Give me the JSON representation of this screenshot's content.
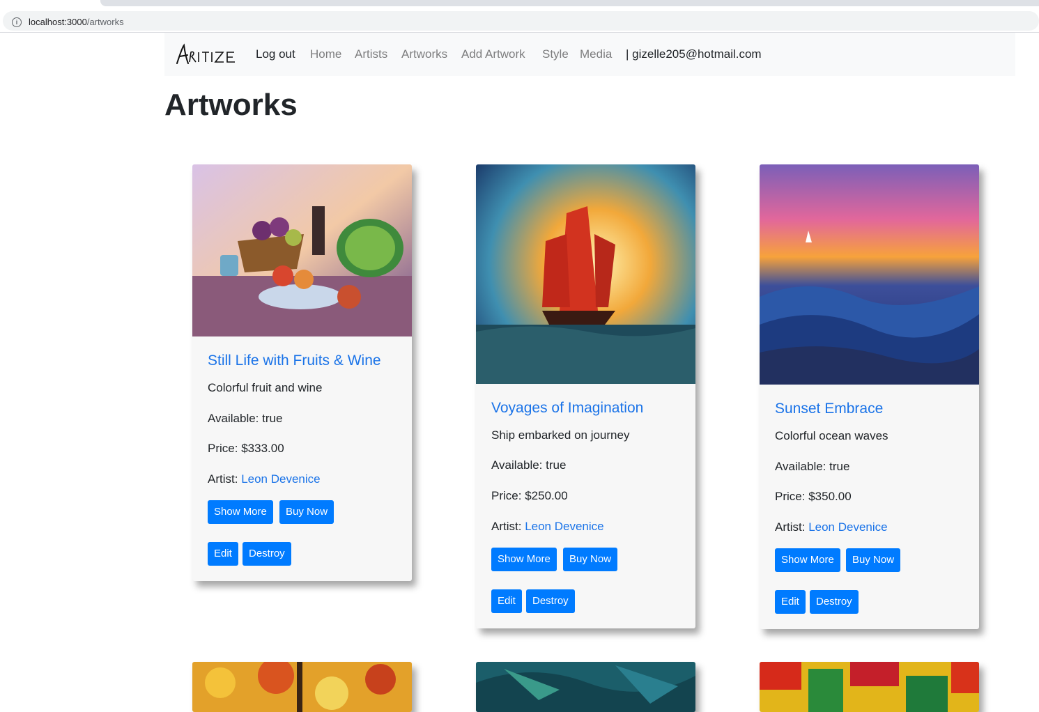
{
  "browser": {
    "url_host": "localhost:3000",
    "url_path": "/artworks"
  },
  "navbar": {
    "brand": "Aritze",
    "items": [
      "Log out",
      "Home",
      "Artists",
      "Artworks",
      "Add Artwork",
      "Style",
      "Media"
    ],
    "user_label": "| gizelle205@hotmail.com"
  },
  "page": {
    "title": "Artworks"
  },
  "labels": {
    "available": "Available:",
    "price": "Price:",
    "artist": "Artist:"
  },
  "buttons": {
    "show_more": "Show More",
    "buy_now": "Buy Now",
    "edit": "Edit",
    "destroy": "Destroy"
  },
  "artworks": [
    {
      "title": "Still Life with Fruits & Wine",
      "description": "Colorful fruit and wine",
      "available": "true",
      "price": "$333.00",
      "artist": "Leon Devenice"
    },
    {
      "title": "Voyages of Imagination",
      "description": "Ship embarked on journey",
      "available": "true",
      "price": "$250.00",
      "artist": "Leon Devenice"
    },
    {
      "title": "Sunset Embrace",
      "description": "Colorful ocean waves",
      "available": "true",
      "price": "$350.00",
      "artist": "Leon Devenice"
    }
  ],
  "colors": {
    "link": "#1a73e8",
    "button": "#007bff",
    "navbar_bg": "#f8f9fa",
    "card_bg": "#f7f7f7"
  }
}
